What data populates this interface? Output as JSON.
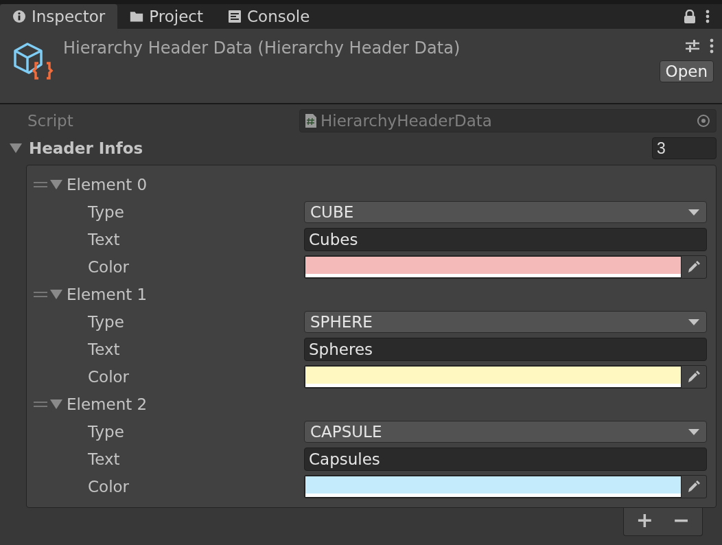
{
  "tabs": [
    {
      "label": "Inspector",
      "kind": "info",
      "selected": true
    },
    {
      "label": "Project",
      "kind": "folder",
      "selected": false
    },
    {
      "label": "Console",
      "kind": "console",
      "selected": false
    }
  ],
  "header": {
    "title": "Hierarchy Header Data (Hierarchy Header Data)",
    "button": "Open"
  },
  "script": {
    "label": "Script",
    "value": "HierarchyHeaderData"
  },
  "list": {
    "label": "Header Infos",
    "expanded": true,
    "count": "3",
    "elements": [
      {
        "label": "Element 0",
        "expanded": true,
        "fields": [
          {
            "kind": "dropdown",
            "label": "Type",
            "value": "CUBE"
          },
          {
            "kind": "text",
            "label": "Text",
            "value": "Cubes"
          },
          {
            "kind": "color",
            "label": "Color",
            "color": "#f4b9b9"
          }
        ]
      },
      {
        "label": "Element 1",
        "expanded": true,
        "fields": [
          {
            "kind": "dropdown",
            "label": "Type",
            "value": "SPHERE"
          },
          {
            "kind": "text",
            "label": "Text",
            "value": "Spheres"
          },
          {
            "kind": "color",
            "label": "Color",
            "color": "#fff9c1"
          }
        ]
      },
      {
        "label": "Element 2",
        "expanded": true,
        "fields": [
          {
            "kind": "dropdown",
            "label": "Type",
            "value": "CAPSULE"
          },
          {
            "kind": "text",
            "label": "Text",
            "value": "Capsules"
          },
          {
            "kind": "color",
            "label": "Color",
            "color": "#c3ebfb"
          }
        ]
      }
    ],
    "add": "+",
    "remove": "−"
  }
}
